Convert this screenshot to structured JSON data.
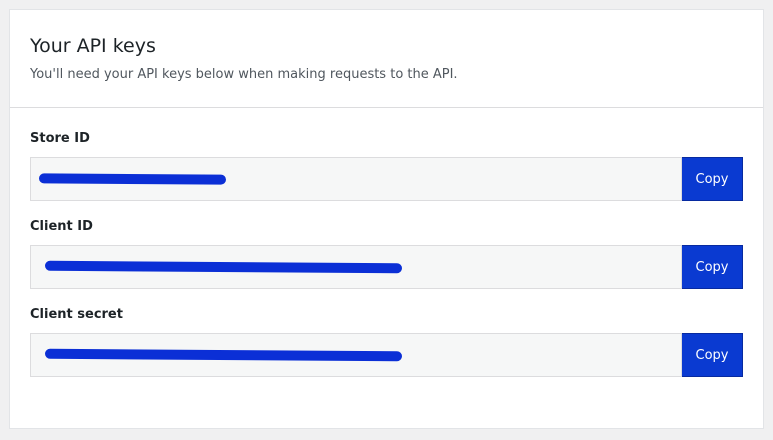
{
  "header": {
    "title": "Your API keys",
    "subtitle": "You'll need your API keys below when making requests to the API."
  },
  "fields": [
    {
      "label": "Store ID",
      "value_obscured": true,
      "copy_label": "Copy"
    },
    {
      "label": "Client ID",
      "value_obscured": true,
      "copy_label": "Copy"
    },
    {
      "label": "Client secret",
      "value_obscured": true,
      "copy_label": "Copy"
    }
  ],
  "colors": {
    "redaction": "#0b2fd6",
    "button": "#0a3ad1"
  }
}
